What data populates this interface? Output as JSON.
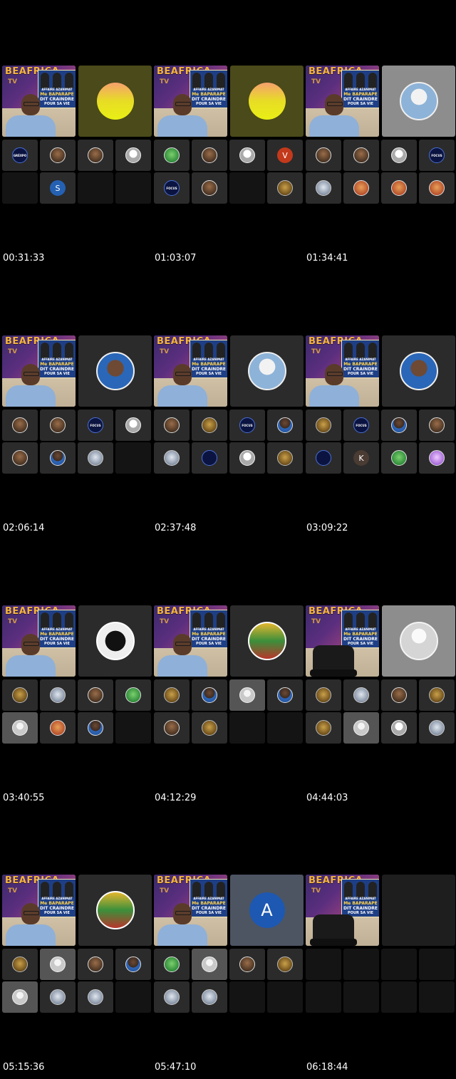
{
  "poster": {
    "brand": "BEAFRICA",
    "brand2": "TV",
    "headline1": "AFFAIRE AZANIMAT",
    "headline2": "Me BAPARAPE",
    "headline3": "DIT CRAINDRE",
    "headline4": "POUR SA VIE"
  },
  "frames": [
    {
      "timestamp": "00:31:33",
      "presenter": "person",
      "right": {
        "style": "sun",
        "bg": "olive-bg",
        "letter": ""
      },
      "small": [
        {
          "type": "av-focus",
          "letter": "GRÉXPO"
        },
        {
          "type": "av-photo",
          "letter": ""
        },
        {
          "type": "av-photo",
          "letter": ""
        },
        {
          "type": "av-white",
          "letter": ""
        },
        {
          "type": "empty",
          "letter": ""
        },
        {
          "type": "av-navy",
          "letter": "S"
        },
        {
          "type": "empty",
          "letter": ""
        },
        {
          "type": "empty",
          "letter": ""
        }
      ]
    },
    {
      "timestamp": "01:03:07",
      "presenter": "person",
      "right": {
        "style": "sun",
        "bg": "olive-bg",
        "letter": ""
      },
      "small": [
        {
          "type": "av-green",
          "letter": ""
        },
        {
          "type": "av-photo",
          "letter": ""
        },
        {
          "type": "av-white",
          "letter": ""
        },
        {
          "type": "av-red",
          "letter": "V"
        },
        {
          "type": "av-focus",
          "letter": "FOCUS"
        },
        {
          "type": "av-photo",
          "letter": ""
        },
        {
          "type": "empty",
          "letter": ""
        },
        {
          "type": "av-gold",
          "letter": ""
        }
      ]
    },
    {
      "timestamp": "01:34:41",
      "presenter": "person",
      "right": {
        "style": "white",
        "bg": "grey-bg",
        "letter": ""
      },
      "small": [
        {
          "type": "av-photo",
          "letter": ""
        },
        {
          "type": "av-photo",
          "letter": ""
        },
        {
          "type": "av-white",
          "letter": ""
        },
        {
          "type": "av-focus",
          "letter": "FOCUS"
        },
        {
          "type": "av-sketch",
          "letter": ""
        },
        {
          "type": "av-orange",
          "letter": ""
        },
        {
          "type": "av-orange",
          "letter": ""
        },
        {
          "type": "av-orange",
          "letter": ""
        }
      ]
    },
    {
      "timestamp": "02:06:14",
      "presenter": "person",
      "right": {
        "style": "photo",
        "bg": "darkgray-bg",
        "letter": ""
      },
      "small": [
        {
          "type": "av-photo",
          "letter": ""
        },
        {
          "type": "av-photo",
          "letter": ""
        },
        {
          "type": "av-focus",
          "letter": "FOCUS"
        },
        {
          "type": "av-white",
          "letter": ""
        },
        {
          "type": "av-photo",
          "letter": ""
        },
        {
          "type": "av-blue",
          "letter": ""
        },
        {
          "type": "av-sketch",
          "letter": ""
        },
        {
          "type": "empty",
          "letter": ""
        }
      ]
    },
    {
      "timestamp": "02:37:48",
      "presenter": "person",
      "right": {
        "style": "white",
        "bg": "darkgray-bg",
        "letter": ""
      },
      "small": [
        {
          "type": "av-photo",
          "letter": ""
        },
        {
          "type": "av-gold",
          "letter": ""
        },
        {
          "type": "av-focus",
          "letter": "FOCUS"
        },
        {
          "type": "av-blue",
          "letter": ""
        },
        {
          "type": "av-sketch",
          "letter": ""
        },
        {
          "type": "av-focus",
          "letter": ""
        },
        {
          "type": "av-white",
          "letter": ""
        },
        {
          "type": "av-gold",
          "letter": ""
        }
      ]
    },
    {
      "timestamp": "03:09:22",
      "presenter": "person",
      "right": {
        "style": "photo",
        "bg": "darkgray-bg",
        "letter": ""
      },
      "small": [
        {
          "type": "av-gold",
          "letter": ""
        },
        {
          "type": "av-focus",
          "letter": "FOCUS"
        },
        {
          "type": "av-blue",
          "letter": ""
        },
        {
          "type": "av-photo",
          "letter": ""
        },
        {
          "type": "av-focus",
          "letter": ""
        },
        {
          "type": "av-brown",
          "letter": "K"
        },
        {
          "type": "av-green",
          "letter": ""
        },
        {
          "type": "av-pink",
          "letter": ""
        }
      ]
    },
    {
      "timestamp": "03:40:55",
      "presenter": "person",
      "right": {
        "style": "mono",
        "bg": "darkgray-bg",
        "letter": ""
      },
      "small": [
        {
          "type": "av-gold",
          "letter": ""
        },
        {
          "type": "av-sketch",
          "letter": ""
        },
        {
          "type": "av-photo",
          "letter": ""
        },
        {
          "type": "av-green",
          "letter": ""
        },
        {
          "type": "av-gray",
          "letter": ""
        },
        {
          "type": "av-orange",
          "letter": ""
        },
        {
          "type": "av-blue",
          "letter": ""
        },
        {
          "type": "empty",
          "letter": ""
        }
      ]
    },
    {
      "timestamp": "04:12:29",
      "presenter": "person",
      "right": {
        "style": "flag",
        "bg": "darkgray-bg",
        "letter": ""
      },
      "small": [
        {
          "type": "av-gold",
          "letter": ""
        },
        {
          "type": "av-blue",
          "letter": ""
        },
        {
          "type": "av-gray",
          "letter": ""
        },
        {
          "type": "av-blue",
          "letter": ""
        },
        {
          "type": "av-photo",
          "letter": ""
        },
        {
          "type": "av-gold",
          "letter": ""
        },
        {
          "type": "empty",
          "letter": ""
        },
        {
          "type": "empty",
          "letter": ""
        }
      ]
    },
    {
      "timestamp": "04:44:03",
      "presenter": "chair",
      "right": {
        "style": "default",
        "bg": "grey-bg",
        "letter": ""
      },
      "small": [
        {
          "type": "av-gold",
          "letter": ""
        },
        {
          "type": "av-sketch",
          "letter": ""
        },
        {
          "type": "av-photo",
          "letter": ""
        },
        {
          "type": "av-gold",
          "letter": ""
        },
        {
          "type": "av-gold",
          "letter": ""
        },
        {
          "type": "av-gray",
          "letter": ""
        },
        {
          "type": "av-white",
          "letter": ""
        },
        {
          "type": "av-sketch",
          "letter": ""
        }
      ]
    },
    {
      "timestamp": "05:15:36",
      "presenter": "person",
      "right": {
        "style": "flag",
        "bg": "darkgray-bg",
        "letter": ""
      },
      "small": [
        {
          "type": "av-gold",
          "letter": ""
        },
        {
          "type": "av-gray",
          "letter": ""
        },
        {
          "type": "av-photo",
          "letter": ""
        },
        {
          "type": "av-blue",
          "letter": ""
        },
        {
          "type": "av-gray",
          "letter": ""
        },
        {
          "type": "av-sketch",
          "letter": ""
        },
        {
          "type": "av-sketch",
          "letter": ""
        },
        {
          "type": "empty",
          "letter": ""
        }
      ]
    },
    {
      "timestamp": "05:47:10",
      "presenter": "person",
      "right": {
        "style": "letter",
        "bg": "slate-bg",
        "letter": "A"
      },
      "small": [
        {
          "type": "av-green",
          "letter": ""
        },
        {
          "type": "av-gray",
          "letter": ""
        },
        {
          "type": "av-photo",
          "letter": ""
        },
        {
          "type": "av-gold",
          "letter": ""
        },
        {
          "type": "av-sketch",
          "letter": ""
        },
        {
          "type": "av-sketch",
          "letter": ""
        },
        {
          "type": "empty",
          "letter": ""
        },
        {
          "type": "empty",
          "letter": ""
        }
      ]
    },
    {
      "timestamp": "06:18:44",
      "presenter": "chair",
      "right": {
        "style": "blank",
        "bg": "black-bg",
        "letter": ""
      },
      "small": [
        {
          "type": "empty",
          "letter": ""
        },
        {
          "type": "empty",
          "letter": ""
        },
        {
          "type": "empty",
          "letter": ""
        },
        {
          "type": "empty",
          "letter": ""
        },
        {
          "type": "empty",
          "letter": ""
        },
        {
          "type": "empty",
          "letter": ""
        },
        {
          "type": "empty",
          "letter": ""
        },
        {
          "type": "empty",
          "letter": ""
        }
      ]
    }
  ]
}
